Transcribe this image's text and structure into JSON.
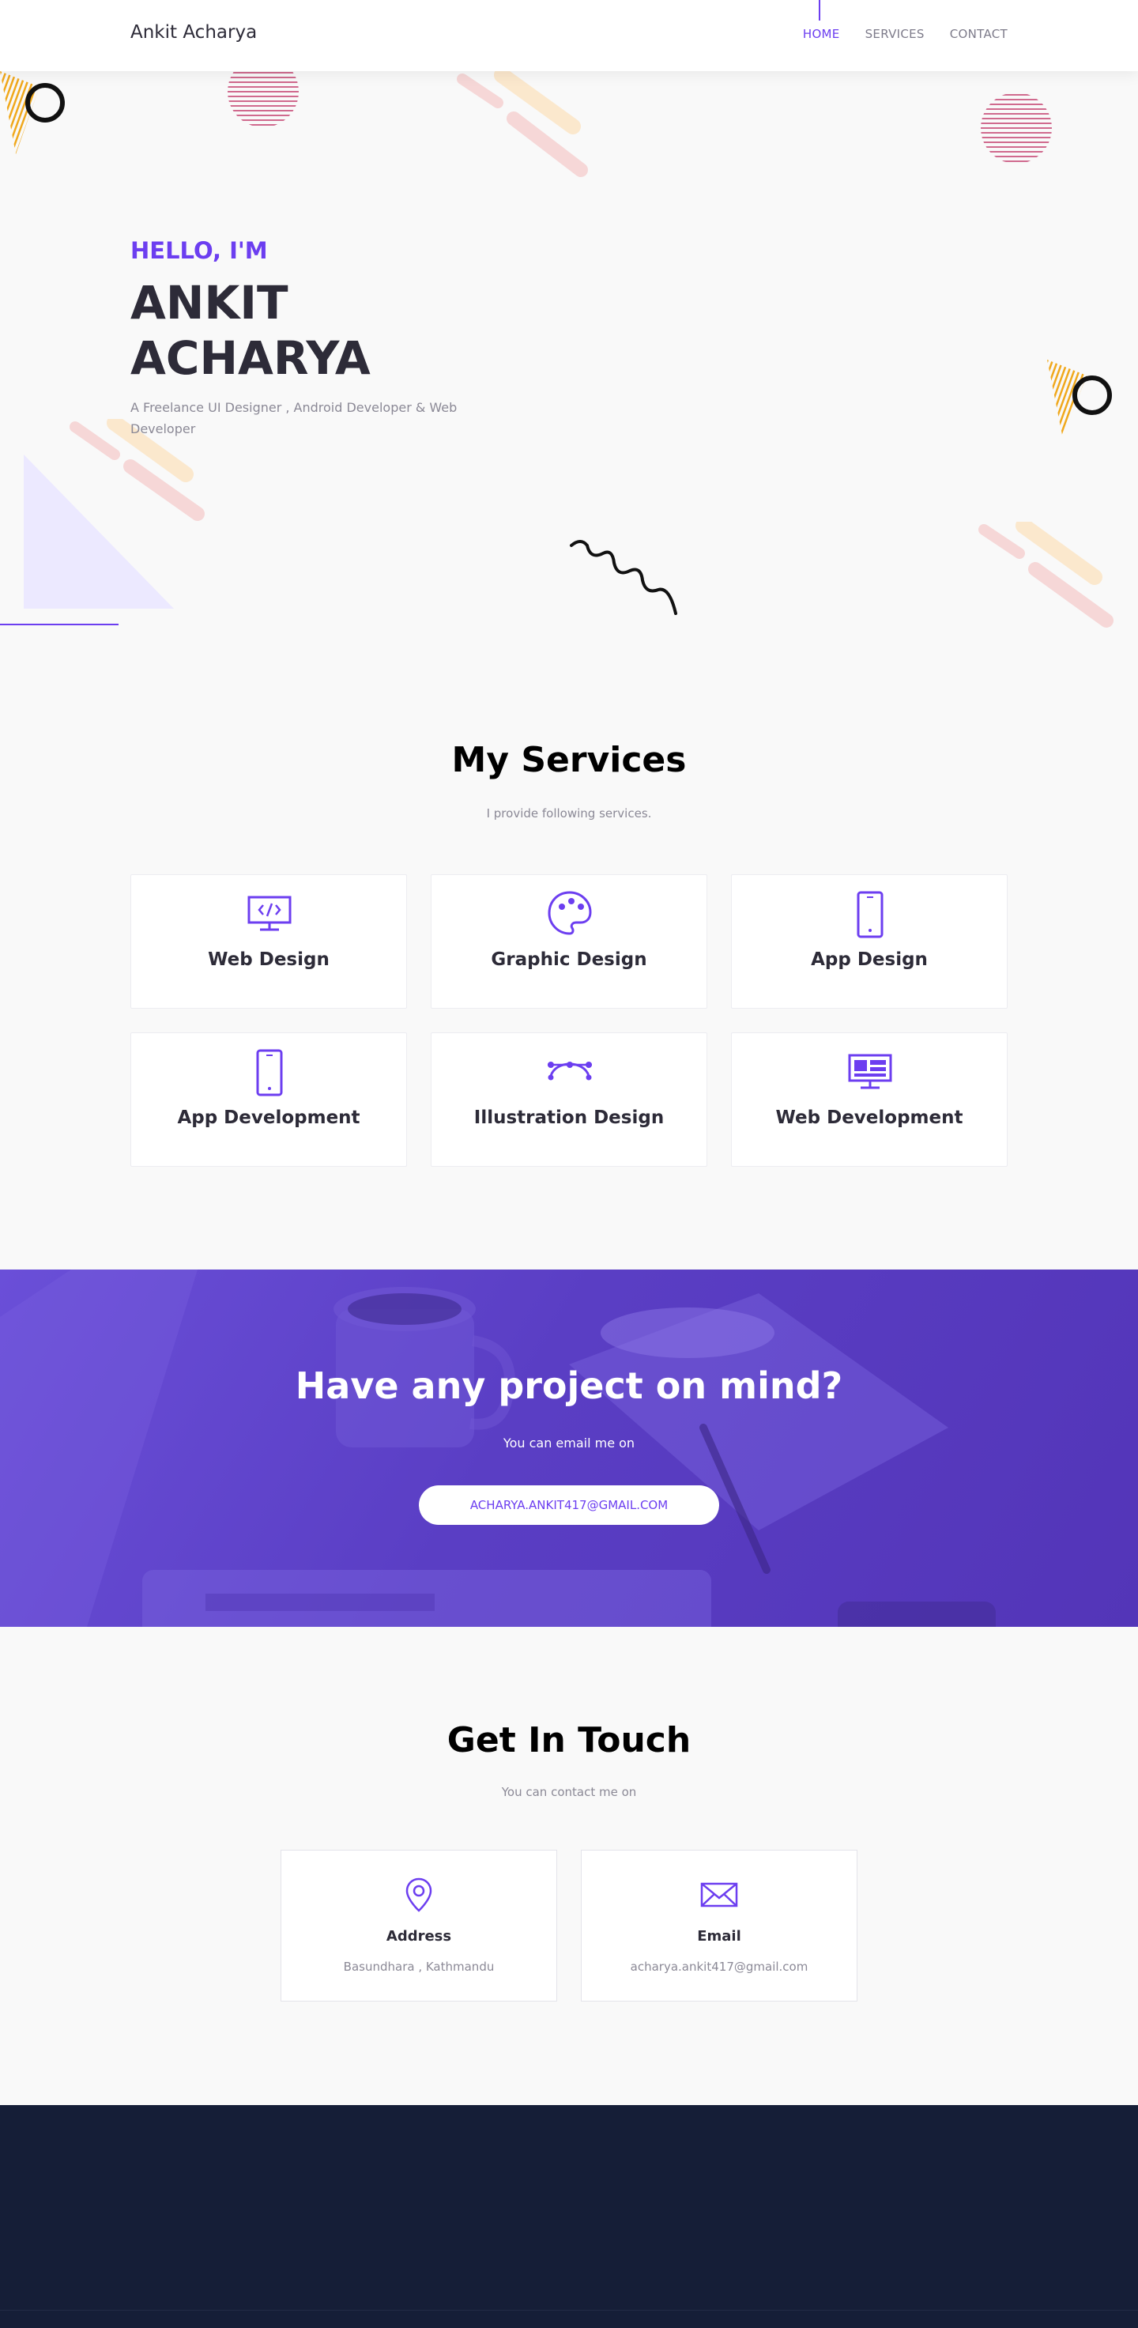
{
  "nav": {
    "brand": "Ankit Acharya",
    "items": [
      {
        "label": "HOME",
        "active": true
      },
      {
        "label": "SERVICES",
        "active": false
      },
      {
        "label": "CONTACT",
        "active": false
      }
    ]
  },
  "hero": {
    "greeting": "HELLO, I'M",
    "name_line1": "ANKIT",
    "name_line2": "ACHARYA",
    "subtitle": "A Freelance UI Designer , Android Developer & Web Developer"
  },
  "services": {
    "title": "My Services",
    "subtitle": "I provide following services.",
    "items": [
      {
        "label": "Web Design",
        "icon": "monitor-code-icon"
      },
      {
        "label": "Graphic Design",
        "icon": "palette-icon"
      },
      {
        "label": "App Design",
        "icon": "smartphone-icon"
      },
      {
        "label": "App Development",
        "icon": "smartphone-icon"
      },
      {
        "label": "Illustration Design",
        "icon": "bezier-curve-icon"
      },
      {
        "label": "Web Development",
        "icon": "monitor-layout-icon"
      }
    ]
  },
  "cta": {
    "title": "Have any project on mind?",
    "subtitle": "You can email me on",
    "button_label": "ACHARYA.ANKIT417@GMAIL.COM"
  },
  "contact": {
    "title": "Get In Touch",
    "subtitle": "You can contact me on",
    "cards": [
      {
        "label": "Address",
        "value": "Basundhara , Kathmandu",
        "icon": "map-pin-icon"
      },
      {
        "label": "Email",
        "value": "acharya.ankit417@gmail.com",
        "icon": "envelope-icon"
      }
    ]
  },
  "colors": {
    "accent": "#6c3ef0",
    "dark_text": "#2d2b38",
    "muted_text": "#8b8996",
    "footer_bg": "#151e37",
    "cta_bg": "#5a3ec4"
  }
}
